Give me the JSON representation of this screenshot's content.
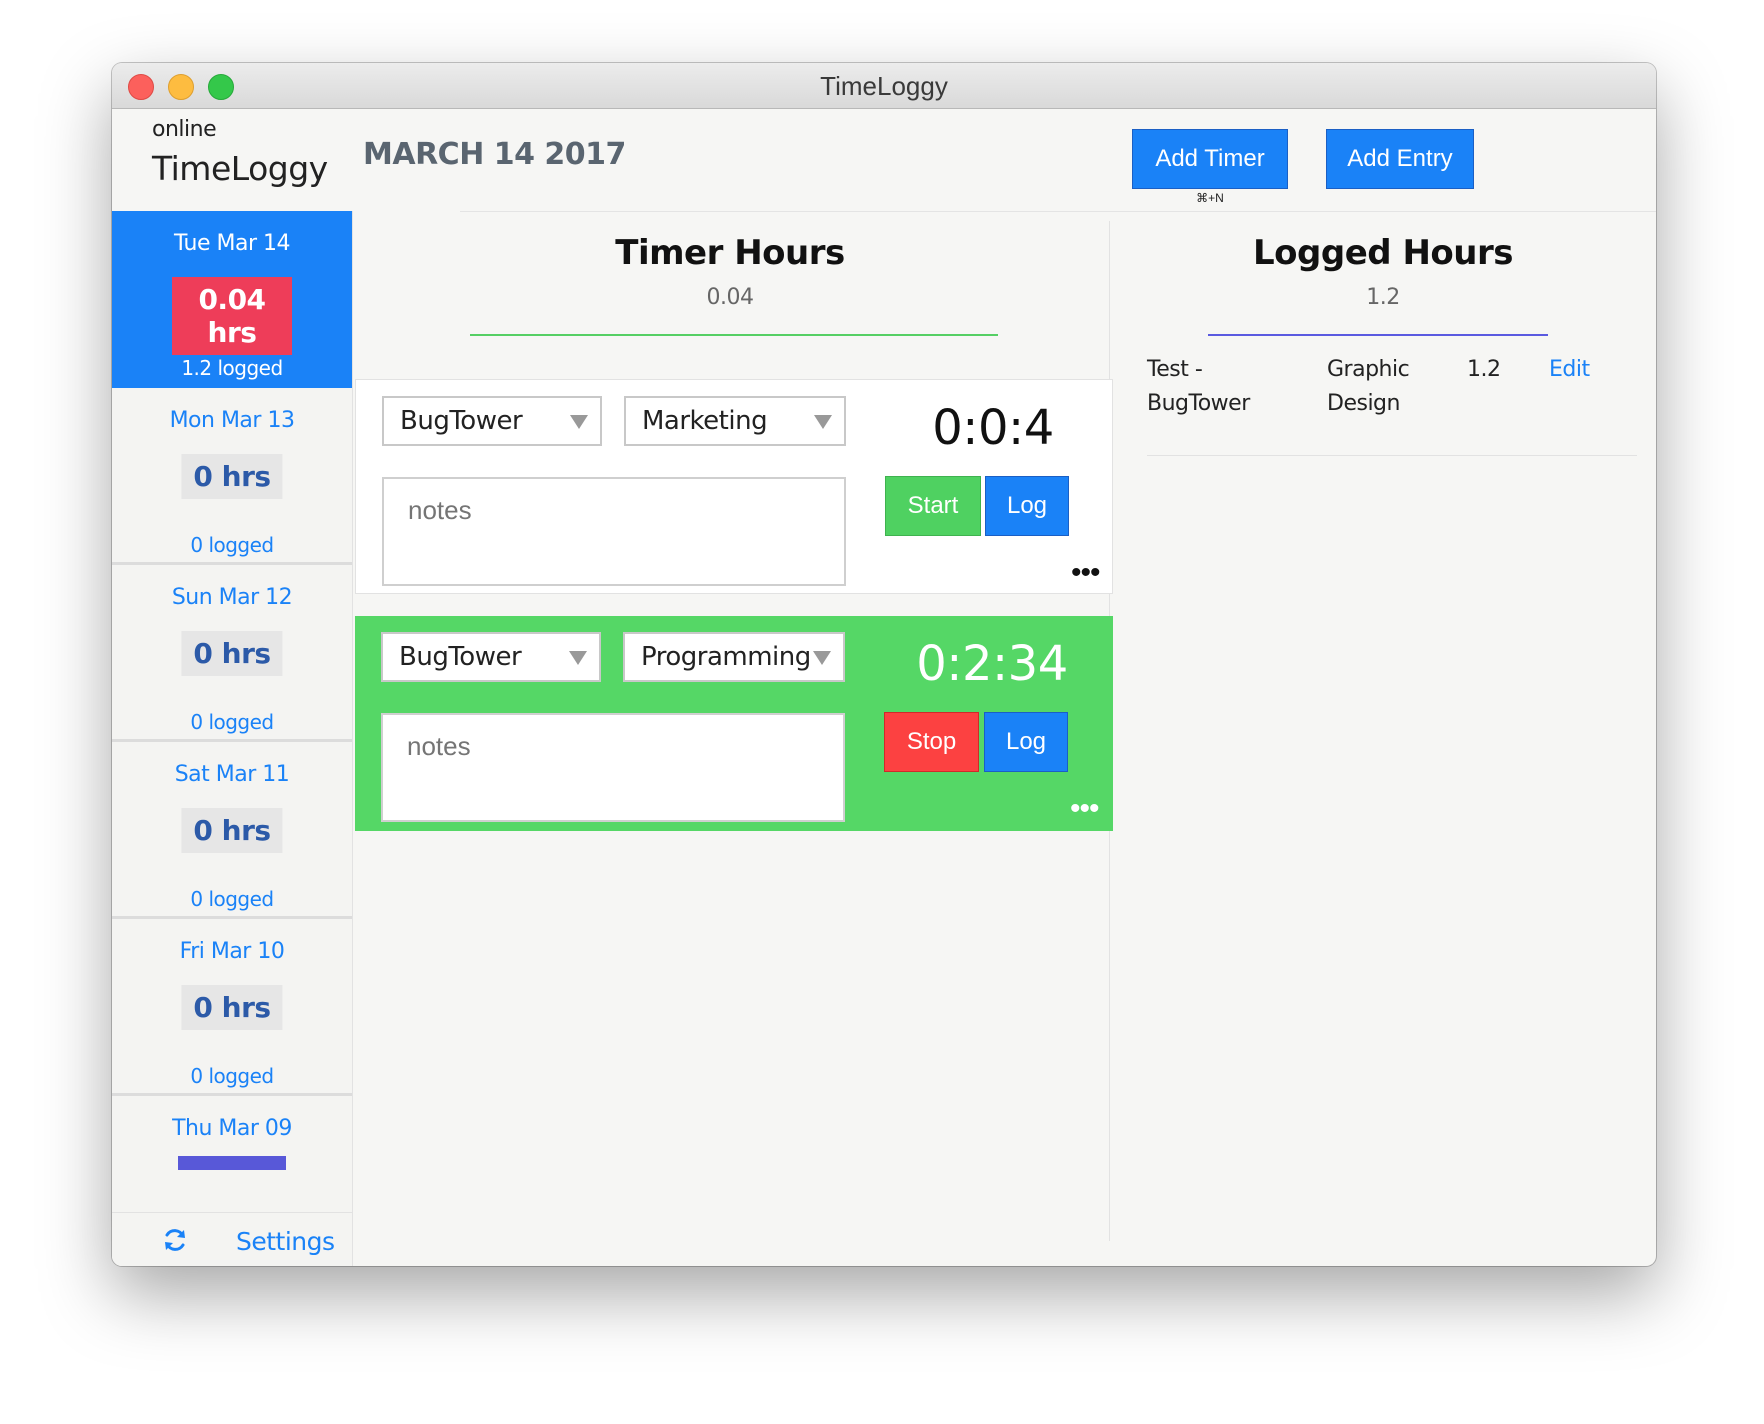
{
  "window": {
    "title": "TimeLoggy"
  },
  "header": {
    "status": "online",
    "brand": "TimeLoggy",
    "date_heading": "MARCH 14 2017",
    "add_timer_label": "Add Timer",
    "add_timer_shortcut": "⌘+N",
    "add_entry_label": "Add Entry"
  },
  "sidebar": {
    "days": [
      {
        "name": "Tue Mar 14",
        "hours": "0.04 hrs",
        "logged": "1.2 logged"
      },
      {
        "name": "Mon Mar 13",
        "hours": "0 hrs",
        "logged": "0 logged"
      },
      {
        "name": "Sun Mar 12",
        "hours": "0 hrs",
        "logged": "0 logged"
      },
      {
        "name": "Sat Mar 11",
        "hours": "0 hrs",
        "logged": "0 logged"
      },
      {
        "name": "Fri Mar 10",
        "hours": "0 hrs",
        "logged": "0 logged"
      },
      {
        "name": "Thu Mar 09"
      }
    ],
    "settings_label": "Settings",
    "refresh_icon": "refresh-icon"
  },
  "timers": {
    "title": "Timer Hours",
    "total": "0.04",
    "items": [
      {
        "client": "BugTower",
        "task": "Marketing",
        "notes_placeholder": "notes",
        "time": "0:0:4",
        "action_label": "Start",
        "log_label": "Log",
        "running": false
      },
      {
        "client": "BugTower",
        "task": "Programming",
        "notes_placeholder": "notes",
        "time": "0:2:34",
        "action_label": "Stop",
        "log_label": "Log",
        "running": true
      }
    ]
  },
  "logged": {
    "title": "Logged Hours",
    "total": "1.2",
    "entries": [
      {
        "project": "Test - BugTower",
        "task": "Graphic Design",
        "hours": "1.2",
        "edit_label": "Edit"
      }
    ]
  },
  "colors": {
    "accent_blue": "#1a82f7",
    "running_green": "#55d766",
    "start_green": "#4fd161",
    "stop_red": "#fc4141",
    "hours_badge_red": "#ee3d59"
  }
}
